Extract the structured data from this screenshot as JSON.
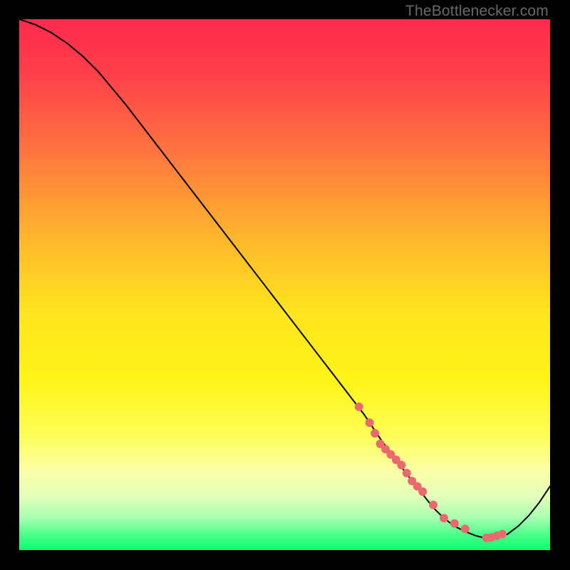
{
  "watermark": "TheBottlenecker.com",
  "chart_data": {
    "type": "line",
    "title": "",
    "xlabel": "",
    "ylabel": "",
    "xlim": [
      0,
      100
    ],
    "ylim": [
      0,
      100
    ],
    "grid": false,
    "x": [
      0,
      3,
      6,
      9,
      12,
      15,
      20,
      25,
      30,
      35,
      40,
      45,
      50,
      55,
      60,
      65,
      68,
      71,
      74,
      76,
      78,
      80,
      82,
      84,
      86,
      88,
      90,
      92,
      94,
      96,
      98,
      100
    ],
    "y": [
      100,
      99,
      97.5,
      95.5,
      93,
      90,
      84,
      77.5,
      71,
      64.5,
      58,
      51.5,
      45,
      38.5,
      32,
      25.5,
      21,
      17,
      13,
      10.5,
      8,
      6,
      4.5,
      3.5,
      2.7,
      2.2,
      2.3,
      3,
      4.5,
      6.5,
      9,
      12
    ],
    "markers": {
      "x": [
        64,
        66,
        67,
        68,
        69,
        70,
        71,
        72,
        73,
        74,
        75,
        76,
        78,
        80,
        82,
        84,
        88,
        89,
        90,
        91
      ],
      "y": [
        27,
        24,
        22,
        20,
        19,
        18,
        17,
        16,
        14.5,
        13,
        12,
        11,
        8.5,
        6,
        5,
        4,
        2.3,
        2.4,
        2.7,
        3
      ]
    },
    "background": {
      "type": "vertical-gradient",
      "stops": [
        {
          "pos": 0.0,
          "color": "#ff2a4d"
        },
        {
          "pos": 0.1,
          "color": "#ff3f4a"
        },
        {
          "pos": 0.25,
          "color": "#ff7540"
        },
        {
          "pos": 0.4,
          "color": "#ffb22d"
        },
        {
          "pos": 0.55,
          "color": "#ffe41e"
        },
        {
          "pos": 0.68,
          "color": "#fff417"
        },
        {
          "pos": 0.78,
          "color": "#fffd55"
        },
        {
          "pos": 0.85,
          "color": "#fbffa7"
        },
        {
          "pos": 0.9,
          "color": "#e2ffbb"
        },
        {
          "pos": 0.94,
          "color": "#a6ffb0"
        },
        {
          "pos": 0.97,
          "color": "#4eff8a"
        },
        {
          "pos": 1.0,
          "color": "#0aff6f"
        }
      ]
    }
  }
}
